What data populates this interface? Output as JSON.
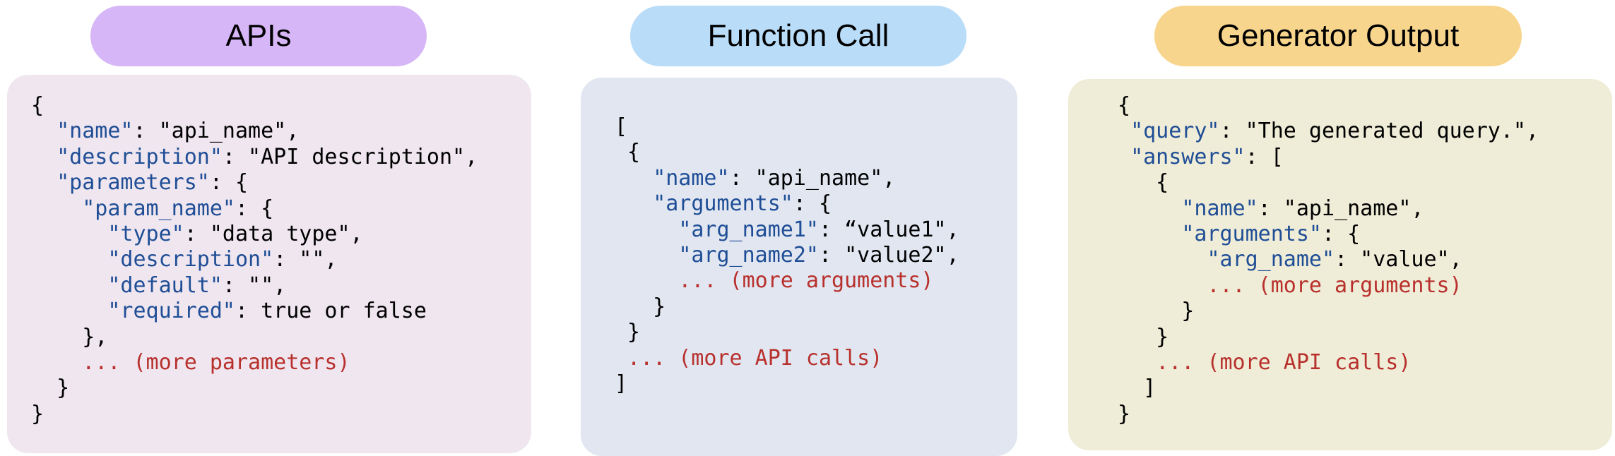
{
  "colors": {
    "apis_pill": "#d7b6f7",
    "apis_panel": "#efe6ef",
    "function_pill": "#b9dcf8",
    "function_panel": "#e1e6f1",
    "generator_pill": "#f7d58d",
    "generator_panel": "#efecd7",
    "key_text": "#1f4e96",
    "more_text": "#b8302c",
    "plain_text": "#000000"
  },
  "panels": [
    {
      "title": "APIs",
      "lines": [
        [
          [
            "p",
            "{"
          ]
        ],
        [
          [
            "p",
            "  "
          ],
          [
            "k",
            "\"name\""
          ],
          [
            "p",
            ": \"api_name\","
          ]
        ],
        [
          [
            "p",
            "  "
          ],
          [
            "k",
            "\"description\""
          ],
          [
            "p",
            ": \"API description\","
          ]
        ],
        [
          [
            "p",
            "  "
          ],
          [
            "k",
            "\"parameters\""
          ],
          [
            "p",
            ": {"
          ]
        ],
        [
          [
            "p",
            "    "
          ],
          [
            "k",
            "\"param_name\""
          ],
          [
            "p",
            ": {"
          ]
        ],
        [
          [
            "p",
            "      "
          ],
          [
            "k",
            "\"type\""
          ],
          [
            "p",
            ": \"data type\","
          ]
        ],
        [
          [
            "p",
            "      "
          ],
          [
            "k",
            "\"description\""
          ],
          [
            "p",
            ": \"\","
          ]
        ],
        [
          [
            "p",
            "      "
          ],
          [
            "k",
            "\"default\""
          ],
          [
            "p",
            ": \"\","
          ]
        ],
        [
          [
            "p",
            "      "
          ],
          [
            "k",
            "\"required\""
          ],
          [
            "p",
            ": true or false"
          ]
        ],
        [
          [
            "p",
            "    },"
          ]
        ],
        [
          [
            "p",
            "    "
          ],
          [
            "m",
            "... (more parameters)"
          ]
        ],
        [
          [
            "p",
            "  }"
          ]
        ],
        [
          [
            "p",
            "}"
          ]
        ]
      ]
    },
    {
      "title": "Function Call",
      "lines": [
        [
          [
            "p",
            "["
          ]
        ],
        [
          [
            "p",
            " {"
          ]
        ],
        [
          [
            "p",
            "   "
          ],
          [
            "k",
            "\"name\""
          ],
          [
            "p",
            ": \"api_name\","
          ]
        ],
        [
          [
            "p",
            "   "
          ],
          [
            "k",
            "\"arguments\""
          ],
          [
            "p",
            ": {"
          ]
        ],
        [
          [
            "p",
            "     "
          ],
          [
            "k",
            "\"arg_name1\""
          ],
          [
            "p",
            ": “value1\","
          ]
        ],
        [
          [
            "p",
            "     "
          ],
          [
            "k",
            "\"arg_name2\""
          ],
          [
            "p",
            ": \"value2\","
          ]
        ],
        [
          [
            "p",
            "     "
          ],
          [
            "m",
            "... (more arguments)"
          ]
        ],
        [
          [
            "p",
            "   }"
          ]
        ],
        [
          [
            "p",
            " }"
          ]
        ],
        [
          [
            "p",
            " "
          ],
          [
            "m",
            "... (more API calls)"
          ]
        ],
        [
          [
            "p",
            "]"
          ]
        ]
      ]
    },
    {
      "title": "Generator Output",
      "lines": [
        [
          [
            "p",
            "{"
          ]
        ],
        [
          [
            "p",
            " "
          ],
          [
            "k",
            "\"query\""
          ],
          [
            "p",
            ": \"The generated query.\","
          ]
        ],
        [
          [
            "p",
            " "
          ],
          [
            "k",
            "\"answers\""
          ],
          [
            "p",
            ": ["
          ]
        ],
        [
          [
            "p",
            "   {"
          ]
        ],
        [
          [
            "p",
            "     "
          ],
          [
            "k",
            "\"name\""
          ],
          [
            "p",
            ": \"api_name\","
          ]
        ],
        [
          [
            "p",
            "     "
          ],
          [
            "k",
            "\"arguments\""
          ],
          [
            "p",
            ": {"
          ]
        ],
        [
          [
            "p",
            "       "
          ],
          [
            "k",
            "\"arg_name\""
          ],
          [
            "p",
            ": \"value\","
          ]
        ],
        [
          [
            "p",
            "       "
          ],
          [
            "m",
            "... (more arguments)"
          ]
        ],
        [
          [
            "p",
            "     }"
          ]
        ],
        [
          [
            "p",
            "   }"
          ]
        ],
        [
          [
            "p",
            "   "
          ],
          [
            "m",
            "... (more API calls)"
          ]
        ],
        [
          [
            "p",
            "  ]"
          ]
        ],
        [
          [
            "p",
            "}"
          ]
        ]
      ]
    }
  ]
}
